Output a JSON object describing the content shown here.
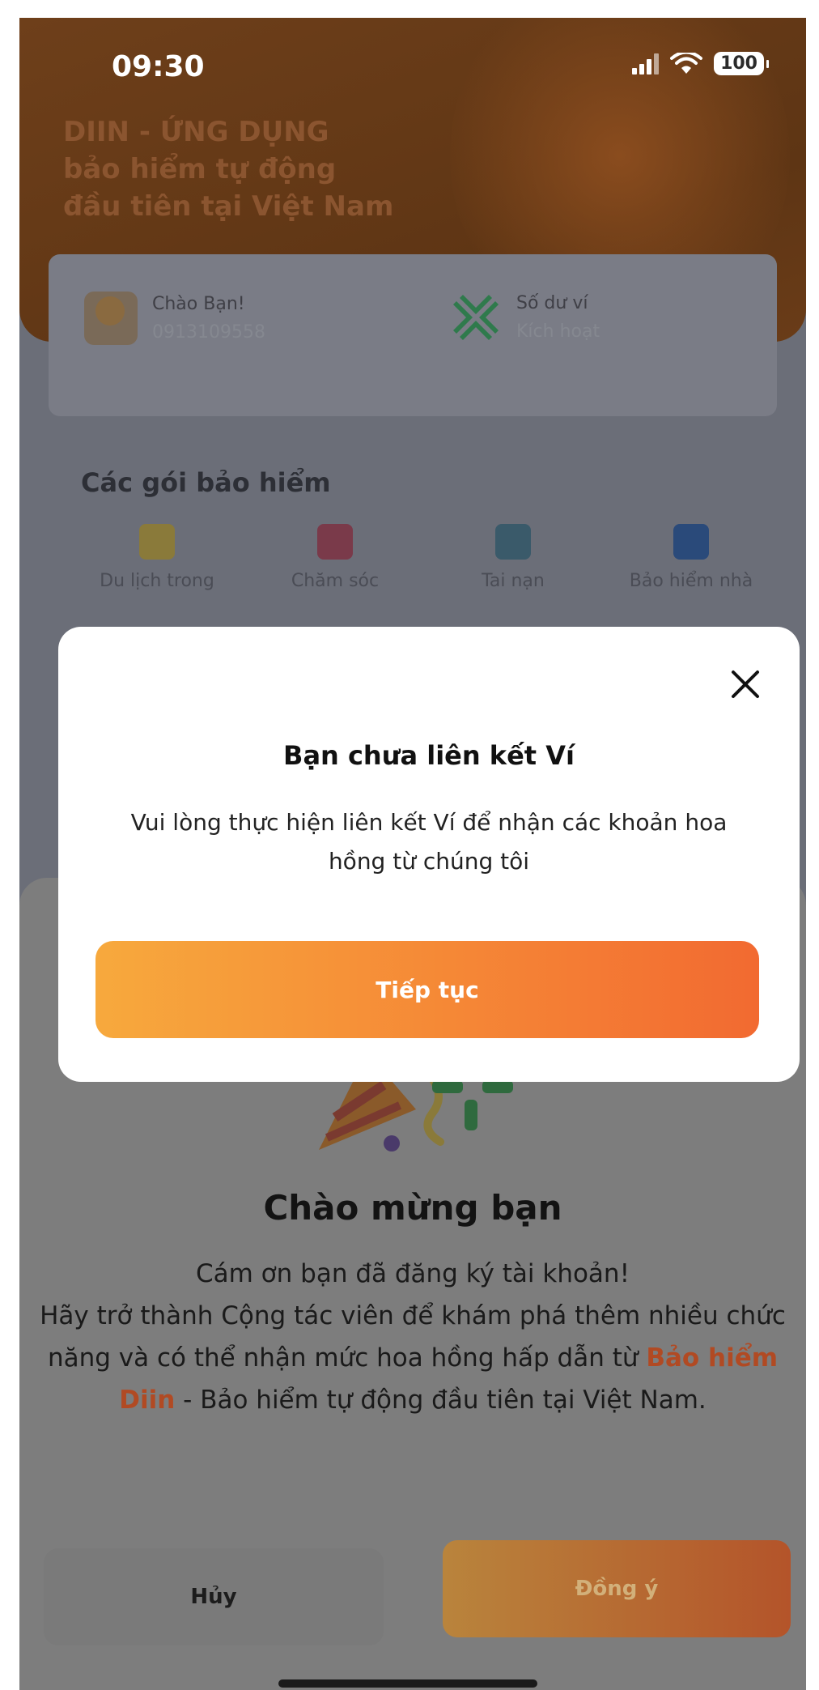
{
  "status_bar": {
    "time": "09:30",
    "battery": "100"
  },
  "hero": {
    "title_lines": [
      "DIIN - ỨNG DỤNG",
      "bảo hiểm tự động",
      "đầu tiên tại Việt Nam"
    ]
  },
  "account_card": {
    "greeting": "Chào Bạn!",
    "phone": "0913109558",
    "wallet_label": "Số dư ví",
    "wallet_status": "Kích hoạt"
  },
  "packages": {
    "title": "Các gói bảo hiểm",
    "items": [
      {
        "label": "Du lịch trong",
        "icon": "luggage-icon"
      },
      {
        "label": "Chăm sóc",
        "icon": "heart-care-icon"
      },
      {
        "label": "Tai nạn",
        "icon": "person-shield-icon"
      },
      {
        "label": "Bảo hiểm nhà",
        "icon": "house-shield-icon"
      }
    ]
  },
  "welcome_sheet": {
    "title": "Chào mừng bạn",
    "line1": "Cám ơn bạn đã đăng ký tài khoản!",
    "body_before": "Hãy trở thành Cộng tác viên để khám phá thêm nhiều chức năng và có thể nhận mức hoa hồng hấp dẫn từ ",
    "brand": "Bảo hiểm Diin",
    "body_after": " - Bảo hiểm tự động đầu tiên tại Việt Nam.",
    "cancel_label": "Hủy",
    "agree_label": "Đồng ý"
  },
  "modal": {
    "title": "Bạn chưa liên kết Ví",
    "message": "Vui lòng thực hiện liên kết Ví để nhận các khoản hoa hồng từ chúng tôi",
    "button_label": "Tiếp tục"
  },
  "colors": {
    "accent_start": "#f7a93d",
    "accent_end": "#f26a31",
    "brand_text": "#e4572e",
    "wallet_green": "#2bb673"
  }
}
